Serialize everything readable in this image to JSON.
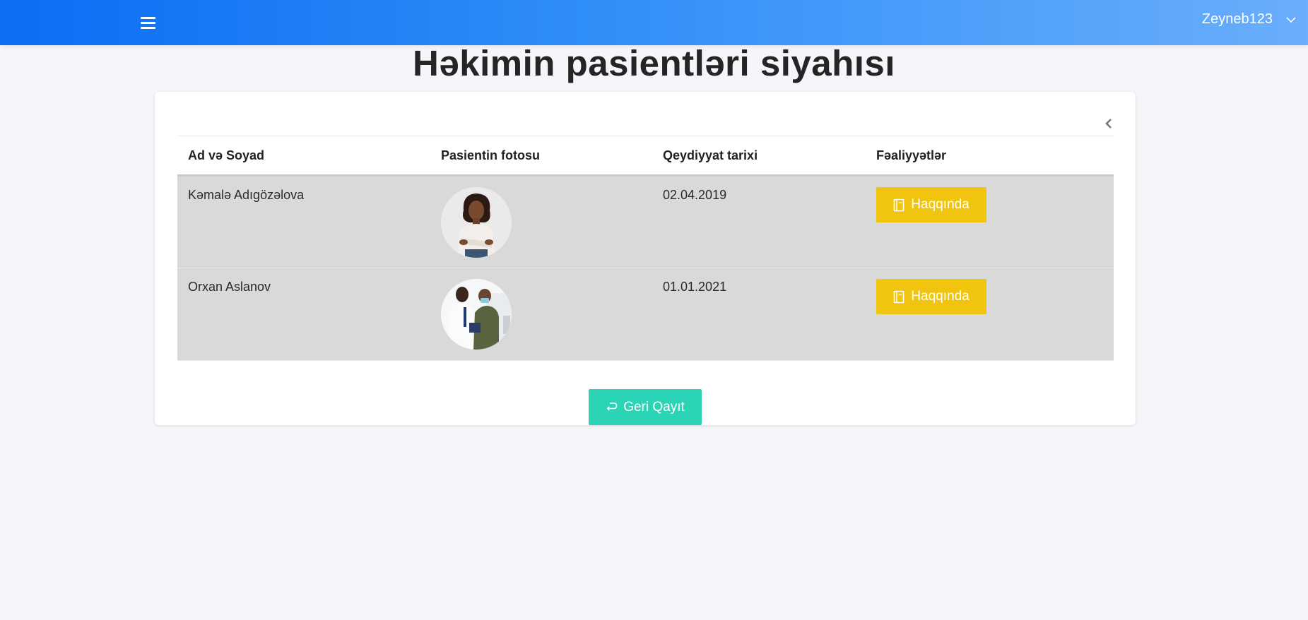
{
  "header": {
    "menu_icon": "hamburger-icon",
    "username": "Zeyneb123",
    "user_dropdown_icon": "chevron-down-icon",
    "gradient": [
      "#0b6df3",
      "#6aaefc"
    ]
  },
  "page": {
    "title": "Həkimin pasientləri siyahısı"
  },
  "table": {
    "columns": [
      "Ad və Soyad",
      "Pasientin fotosu",
      "Qeydiyyat tarixi",
      "Fəaliyyətlər"
    ],
    "rows": [
      {
        "name": "Kəmalə Adıgözəlova",
        "photo": "patient-photo-woman",
        "date": "02.04.2019",
        "action": "Haqqında"
      },
      {
        "name": "Orxan Aslanov",
        "photo": "patient-photo-clinic",
        "date": "01.01.2021",
        "action": "Haqqında"
      }
    ],
    "collapse_icon": "chevron-left-icon"
  },
  "footer": {
    "back_label": "Geri Qayıt",
    "back_icon": "return-arrow-icon"
  },
  "colors": {
    "action_button": "#f1c40f",
    "back_button": "#2bd4b4",
    "row_background": "#d9d9d9"
  }
}
